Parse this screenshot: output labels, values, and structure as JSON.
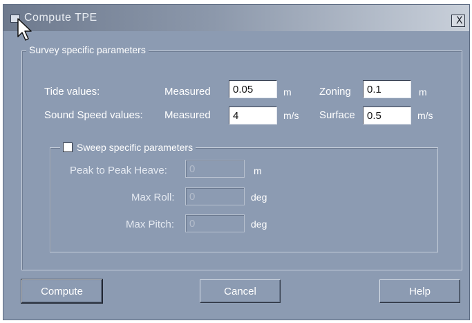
{
  "window": {
    "title": "Compute TPE",
    "close_glyph": "X"
  },
  "survey_group": {
    "legend": "Survey specific parameters",
    "tide": {
      "label": "Tide values:",
      "measured_label": "Measured",
      "measured_value": "0.05",
      "measured_unit": "m",
      "zoning_label": "Zoning",
      "zoning_value": "0.1",
      "zoning_unit": "m"
    },
    "sound_speed": {
      "label": "Sound Speed values:",
      "measured_label": "Measured",
      "measured_value": "4",
      "measured_unit": "m/s",
      "surface_label": "Surface",
      "surface_value": "0.5",
      "surface_unit": "m/s"
    }
  },
  "sweep_group": {
    "legend": "Sweep specific parameters",
    "checked": false,
    "peak_heave": {
      "label": "Peak to Peak Heave:",
      "value": "0",
      "unit": "m"
    },
    "max_roll": {
      "label": "Max Roll:",
      "value": "0",
      "unit": "deg"
    },
    "max_pitch": {
      "label": "Max Pitch:",
      "value": "0",
      "unit": "deg"
    }
  },
  "buttons": {
    "compute": "Compute",
    "cancel": "Cancel",
    "help": "Help"
  },
  "colors": {
    "dialog_background": "#8c9bb2",
    "title_gradient_start": "#6e7a8e",
    "title_gradient_end": "#c9d0da"
  },
  "icons": {
    "title": "app-window-icon",
    "cursor": "mouse-pointer-icon",
    "close": "close-icon"
  }
}
